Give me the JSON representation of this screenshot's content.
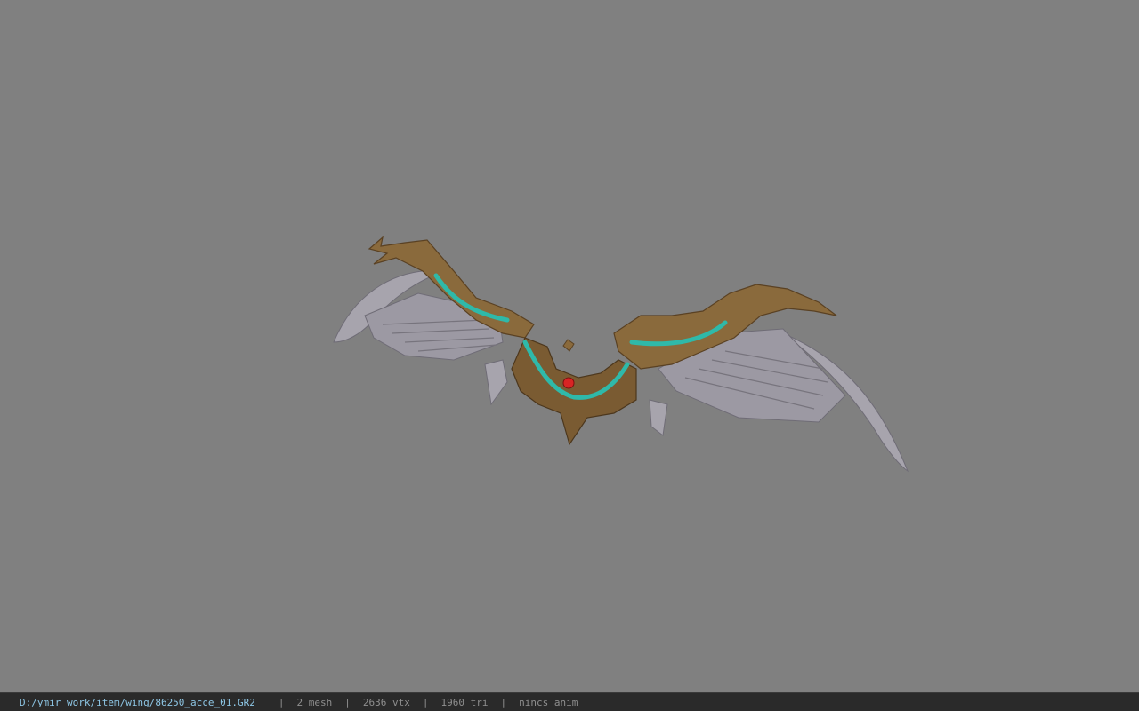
{
  "viewer": {
    "background_color": "#808080",
    "model": {
      "name": "winged-accessory-model",
      "colors": {
        "gold": "#8a6a3c",
        "gold_dark": "#5a4123",
        "teal": "#2fb9a9",
        "blade": "#a7a4ad",
        "blade_dark": "#6f6c76",
        "gem": "#d82424"
      }
    }
  },
  "status_bar": {
    "file_path": "D:/ymir work/item/wing/86250_acce_01.GR2",
    "separator": "|",
    "mesh_count": "2 mesh",
    "vertex_count": "2636 vtx",
    "triangle_count": "1960 tri",
    "animation": "nincs anim",
    "background_color": "#2a2a2a",
    "path_color": "#8ec7e6",
    "text_color": "#8f8f8f"
  }
}
